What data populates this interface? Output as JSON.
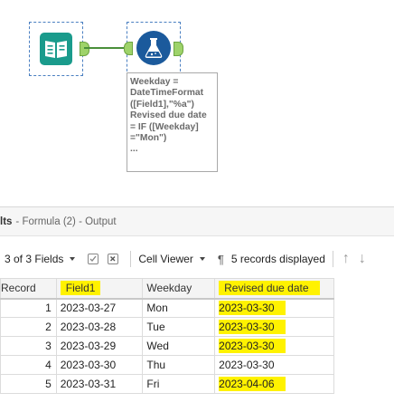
{
  "workflow": {
    "annotation_text": "Weekday =\nDateTimeFormat\n([Field1],\"%a\")\nRevised due date\n= IF ([Weekday]\n=\"Mon\")\n..."
  },
  "results": {
    "title_strong": "lts",
    "title_rest": "- Formula (2) - Output",
    "fields_selector": "3 of 3 Fields",
    "viewer_selector": "Cell Viewer",
    "pilcrow": "¶",
    "record_count": "5 records displayed",
    "up_arrow": "↑",
    "down_arrow": "↓"
  },
  "table": {
    "headers": [
      "Record",
      "Field1",
      "Weekday",
      "Revised due date"
    ],
    "rows": [
      [
        "1",
        "2023-03-27",
        "Mon",
        "2023-03-30"
      ],
      [
        "2",
        "2023-03-28",
        "Tue",
        "2023-03-30"
      ],
      [
        "3",
        "2023-03-29",
        "Wed",
        "2023-03-30"
      ],
      [
        "4",
        "2023-03-30",
        "Thu",
        "2023-03-30"
      ],
      [
        "5",
        "2023-03-31",
        "Fri",
        "2023-04-06"
      ]
    ]
  },
  "colors": {
    "highlight": "#fff200",
    "input_tool": "#1a9b8c",
    "formula_tool": "#1b5a9c",
    "anchor": "#9ed36a"
  }
}
